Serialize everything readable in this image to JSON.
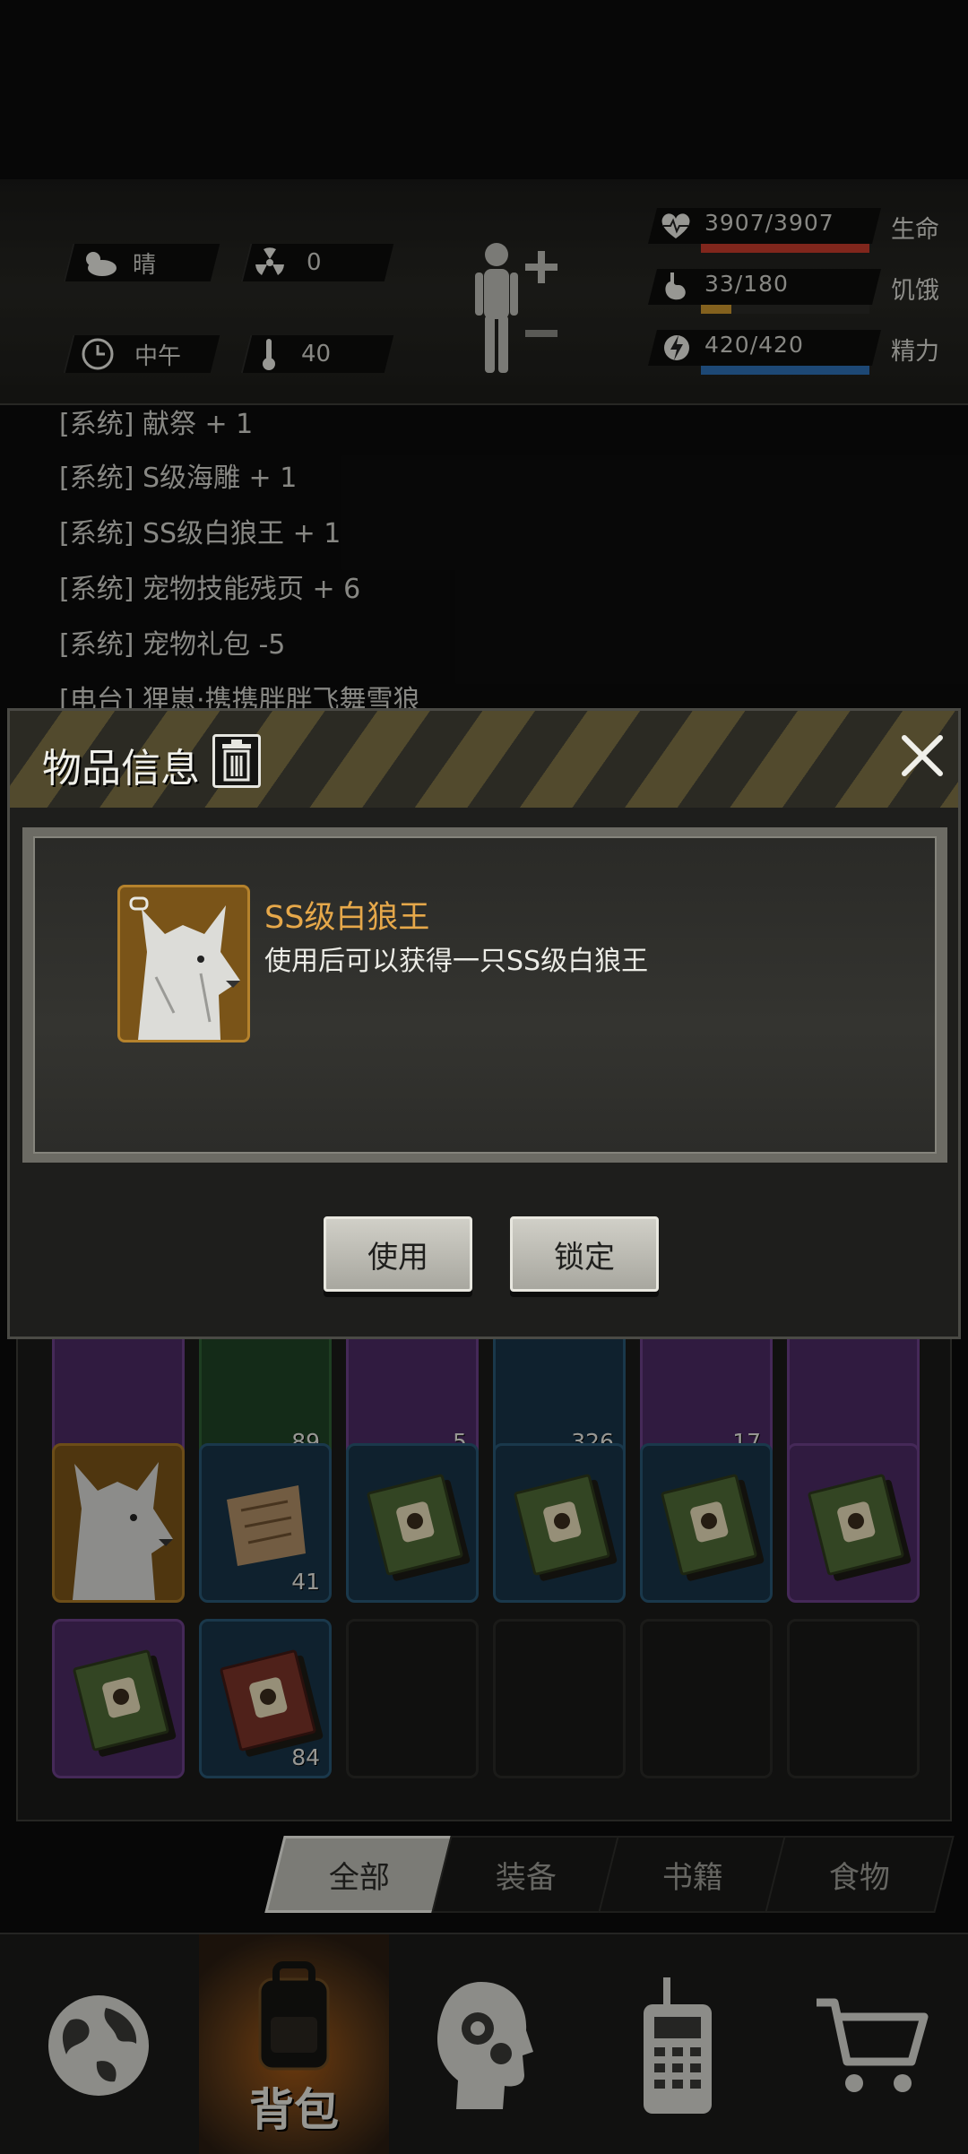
{
  "hud": {
    "weather": "晴",
    "radiation": "0",
    "time_of_day": "中午",
    "temperature": "40",
    "stats": [
      {
        "value": "3907/3907",
        "name": "生命",
        "fill": 1.0,
        "color": "#c53b2c"
      },
      {
        "value": "33/180",
        "name": "饥饿",
        "fill": 0.18,
        "color": "#c9962e"
      },
      {
        "value": "420/420",
        "name": "精力",
        "fill": 1.0,
        "color": "#2d6fb4"
      }
    ]
  },
  "log": {
    "lines": [
      "[系统] 献祭 + 1",
      "[系统] S级海雕 + 1",
      "[系统] SS级白狼王 + 1",
      "[系统] 宠物技能残页 + 6",
      "[系统] 宠物礼包 -5",
      "[电台] 狸崽·携携胖胖飞舞雪狼"
    ]
  },
  "inventory": {
    "row1_counts": [
      "",
      "89",
      "5",
      "326",
      "17",
      ""
    ],
    "row2_counts": [
      "",
      "41",
      "",
      "",
      "",
      ""
    ],
    "row3_counts": [
      "",
      "84",
      "",
      "",
      "",
      ""
    ]
  },
  "tabs": [
    "全部",
    "装备",
    "书籍",
    "食物"
  ],
  "nav": {
    "items": [
      {
        "icon": "globe-icon",
        "label": ""
      },
      {
        "icon": "backpack-icon",
        "label": "背包"
      },
      {
        "icon": "brain-gear-icon",
        "label": ""
      },
      {
        "icon": "radio-icon",
        "label": ""
      },
      {
        "icon": "cart-icon",
        "label": ""
      }
    ]
  },
  "dialog": {
    "title": "物品信息",
    "item_name": "SS级白狼王",
    "item_desc": "使用后可以获得一只SS级白狼王",
    "use_label": "使用",
    "lock_label": "锁定"
  }
}
